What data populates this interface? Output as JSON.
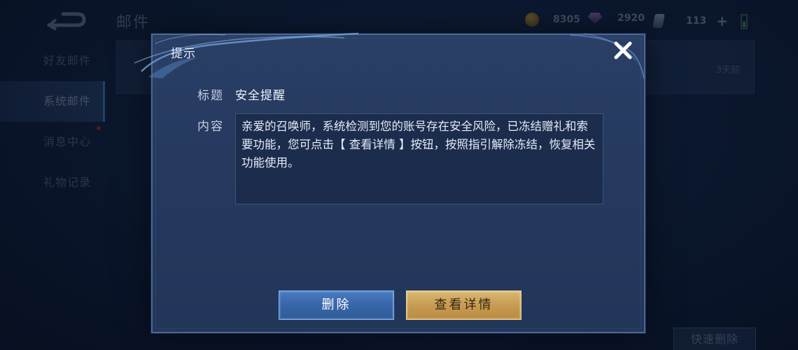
{
  "topbar": {
    "page_title": "邮件",
    "coins": "8305",
    "gems": "2920",
    "tickets": "113",
    "plus_glyph": "+"
  },
  "sidebar": {
    "items": [
      {
        "label": "好友邮件",
        "active": false
      },
      {
        "label": "系统邮件",
        "active": true
      },
      {
        "label": "消息中心",
        "active": false
      },
      {
        "label": "礼物记录",
        "active": false
      }
    ]
  },
  "mail_list": {
    "rows": [
      {
        "age": "3天前"
      }
    ],
    "quick_delete_label": "快速删除"
  },
  "dialog": {
    "title": "提示",
    "subject_label": "标题",
    "subject_value": "安全提醒",
    "content_label": "内容",
    "content_value": "亲爱的召唤师，系统检测到您的账号存在安全风险，已冻结赠礼和索要功能，您可点击【 查看详情 】按钮，按照指引解除冻结，恢复相关功能使用。",
    "delete_label": "删除",
    "detail_label": "查看详情",
    "close_icon": "close-icon"
  },
  "colors": {
    "dialog_bg": "#263a60",
    "delete_button": "#3766a8",
    "detail_button": "#c79c52"
  }
}
